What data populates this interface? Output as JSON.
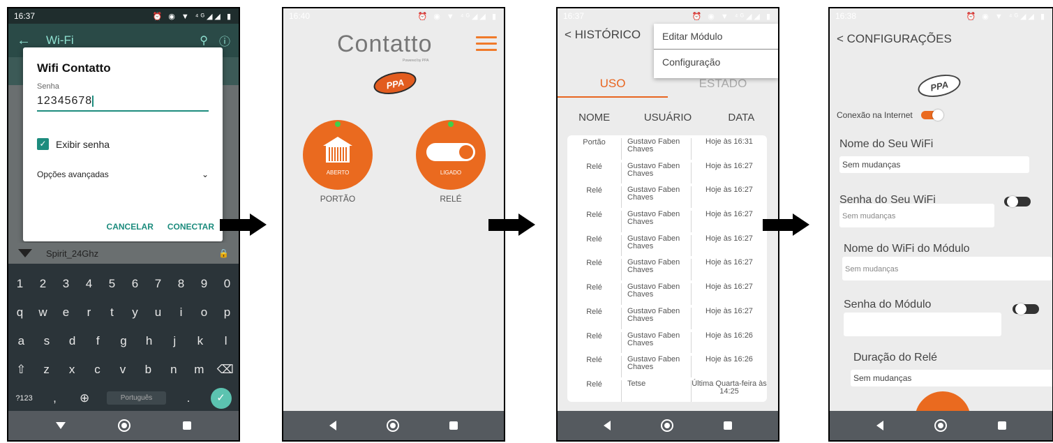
{
  "phone1": {
    "status_time": "16:37",
    "status_icons": "⏰ ◉ ▼ ⁴ᴳ◢◢ ▮",
    "header_title": "Wi-Fi",
    "dialog": {
      "title": "Wifi Contatto",
      "password_label": "Senha",
      "password_value": "12345678",
      "show_password": "Exibir senha",
      "advanced": "Opções avançadas",
      "cancel": "CANCELAR",
      "connect": "CONECTAR"
    },
    "network_item": "Spirit_24Ghz",
    "keyboard": {
      "row1": [
        "1",
        "2",
        "3",
        "4",
        "5",
        "6",
        "7",
        "8",
        "9",
        "0"
      ],
      "row2": [
        "q",
        "w",
        "e",
        "r",
        "t",
        "y",
        "u",
        "i",
        "o",
        "p"
      ],
      "row3": [
        "a",
        "s",
        "d",
        "f",
        "g",
        "h",
        "j",
        "k",
        "l"
      ],
      "row4": [
        "⇧",
        "z",
        "x",
        "c",
        "v",
        "b",
        "n",
        "m",
        "⌫"
      ],
      "symbols": "?123",
      "comma": ",",
      "globe": "⊕",
      "space_label": "Português",
      "period": ".",
      "enter": "✓"
    }
  },
  "phone2": {
    "status_time": "16:40",
    "logo_text": "Contatto",
    "logo_sub": "Powered by PPA",
    "ppa": "PPA",
    "gate": {
      "state": "ABERTO",
      "label": "PORTÃO"
    },
    "relay": {
      "state": "LIGADO",
      "label": "RELÉ"
    }
  },
  "phone3": {
    "status_time": "16:37",
    "title": "< HISTÓRICO",
    "menu": [
      "Editar Módulo",
      "Configuração"
    ],
    "tabs": [
      "USO",
      "ESTADO"
    ],
    "columns": [
      "NOME",
      "USUÁRIO",
      "DATA"
    ],
    "rows": [
      [
        "Portão",
        "Gustavo Faben Chaves",
        "Hoje às 16:31"
      ],
      [
        "Relé",
        "Gustavo Faben Chaves",
        "Hoje às 16:27"
      ],
      [
        "Relé",
        "Gustavo Faben Chaves",
        "Hoje às 16:27"
      ],
      [
        "Relé",
        "Gustavo Faben Chaves",
        "Hoje às 16:27"
      ],
      [
        "Relé",
        "Gustavo Faben Chaves",
        "Hoje às 16:27"
      ],
      [
        "Relé",
        "Gustavo Faben Chaves",
        "Hoje às 16:27"
      ],
      [
        "Relé",
        "Gustavo Faben Chaves",
        "Hoje às 16:27"
      ],
      [
        "Relé",
        "Gustavo Faben Chaves",
        "Hoje às 16:27"
      ],
      [
        "Relé",
        "Gustavo Faben Chaves",
        "Hoje às 16:26"
      ],
      [
        "Relé",
        "Gustavo Faben Chaves",
        "Hoje às 16:26"
      ],
      [
        "Relé",
        "Tetse",
        "Última Quarta-feira às 14:25"
      ]
    ]
  },
  "phone4": {
    "status_time": "16:38",
    "title": "< CONFIGURAÇÕES",
    "ppa": "PPA",
    "internet_label": "Conexão na Internet",
    "wifi_name_label": "Nome do Seu WiFi",
    "wifi_name_value": "Sem mudanças",
    "wifi_pass_label": "Senha do Seu WiFi",
    "wifi_pass_placeholder": "Sem mudanças",
    "module_wifi_label": "Nome do WiFi do Módulo",
    "module_wifi_placeholder": "Sem mudanças",
    "module_pass_label": "Senha do Módulo",
    "relay_duration_label": "Duração do Relé",
    "relay_duration_value": "Sem mudanças"
  },
  "colors": {
    "accent_orange": "#ea6a1f",
    "teal": "#1d8c7e",
    "status_green": "#3fd14a"
  }
}
